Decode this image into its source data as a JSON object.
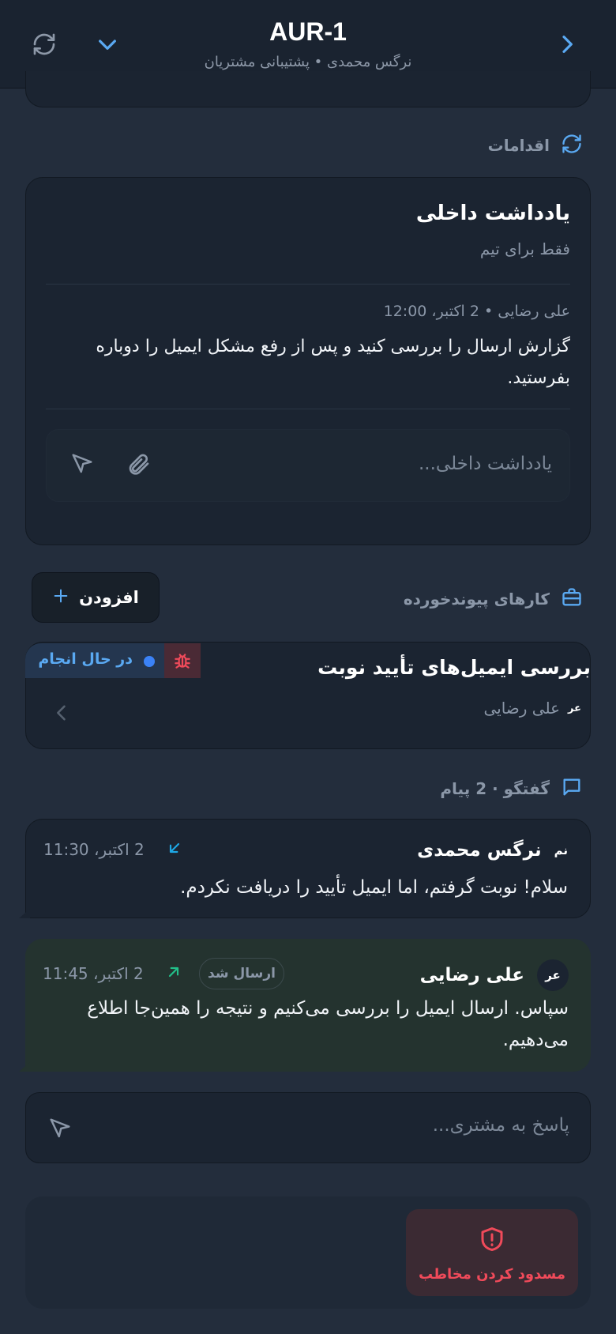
{
  "header": {
    "title": "AUR-1",
    "subtitle": "نرگس محمدی • پشتیبانی مشتریان"
  },
  "actions": {
    "label": "اقدامات"
  },
  "internal_note": {
    "title": "یادداشت داخلی",
    "subtitle": "فقط برای تیم",
    "author_meta": "علی رضایی • 2 اکتبر، 12:00",
    "body": "گزارش ارسال را بررسی کنید و پس از رفع مشکل ایمیل را دوباره بفرستید.",
    "input_placeholder": "یادداشت داخلی..."
  },
  "linked_tasks": {
    "label": "کارهای پیوندخورده",
    "add_label": "افزودن",
    "items": [
      {
        "title": "بررسی ایمیل‌های تأیید نوبت",
        "status": "در حال انجام",
        "assignee_initials": "عر",
        "assignee": "علی رضایی"
      }
    ]
  },
  "conversation": {
    "label": "گفتگو · 2 پیام",
    "messages": [
      {
        "initials": "نم",
        "sender": "نرگس محمدی",
        "time": "2 اکتبر، 11:30",
        "text": "سلام! نوبت گرفتم، اما ایمیل تأیید را دریافت نکردم."
      },
      {
        "initials": "عر",
        "sender": "علی رضایی",
        "badge": "ارسال شد",
        "time": "2 اکتبر، 11:45",
        "text": "سپاس. ارسال ایمیل را بررسی می‌کنیم و نتیجه را همین‌جا اطلاع می‌دهیم."
      }
    ]
  },
  "reply": {
    "placeholder": "پاسخ به مشتری..."
  },
  "block": {
    "label": "مسدود کردن مخاطب"
  },
  "colors": {
    "accent": "#5aa9f2",
    "danger": "#f04a5a",
    "status_blue": "#3b82f6",
    "incoming_arrow": "#1ea7e4",
    "outgoing_arrow": "#22c08a"
  }
}
